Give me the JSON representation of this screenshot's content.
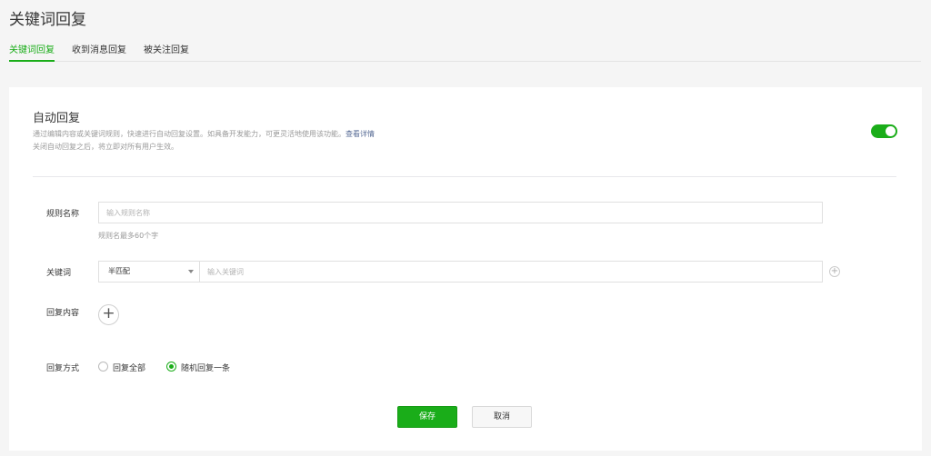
{
  "page": {
    "title": "关键词回复"
  },
  "tabs": [
    {
      "label": "关键词回复",
      "active": true
    },
    {
      "label": "收到消息回复",
      "active": false
    },
    {
      "label": "被关注回复",
      "active": false
    }
  ],
  "auto_reply": {
    "title": "自动回复",
    "desc_line1": "通过编辑内容或关键词规则，快速进行自动回复设置。如具备开发能力，可更灵活地使用该功能。",
    "desc_link": "查看详情",
    "desc_line2": "关闭自动回复之后，将立即对所有用户生效。",
    "enabled": true
  },
  "form": {
    "rule_name": {
      "label": "规则名称",
      "placeholder": "输入规则名称",
      "hint": "规则名最多60个字"
    },
    "keyword": {
      "label": "关键词",
      "match_mode": "半匹配",
      "placeholder": "输入关键词"
    },
    "reply_content": {
      "label": "回复内容"
    },
    "reply_mode": {
      "label": "回复方式",
      "options": [
        {
          "label": "回复全部",
          "checked": false
        },
        {
          "label": "随机回复一条",
          "checked": true
        }
      ]
    }
  },
  "buttons": {
    "save": "保存",
    "cancel": "取消"
  },
  "colors": {
    "accent": "#1aad19",
    "link": "#576b95"
  },
  "icons": {
    "add": "plus-icon",
    "dropdown": "chevron-down-icon"
  }
}
